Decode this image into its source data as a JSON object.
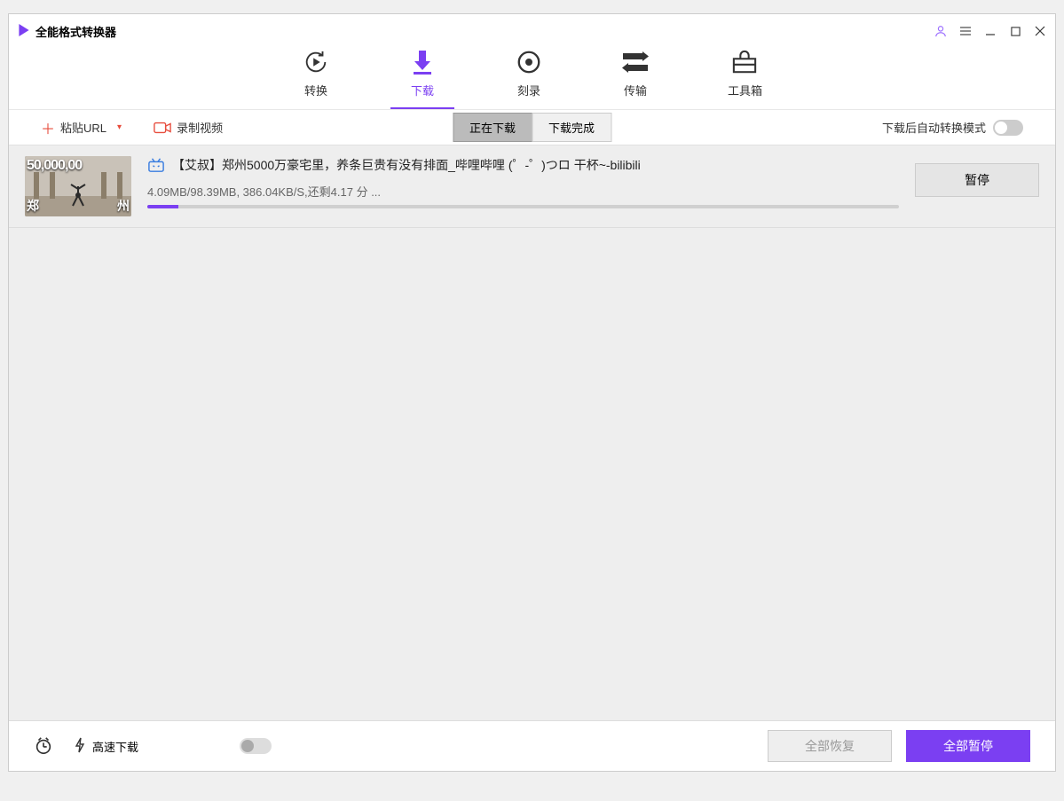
{
  "app": {
    "title": "全能格式转换器"
  },
  "nav": {
    "items": [
      {
        "label": "转换"
      },
      {
        "label": "下载"
      },
      {
        "label": "刻录"
      },
      {
        "label": "传输"
      },
      {
        "label": "工具箱"
      }
    ]
  },
  "toolbar": {
    "paste_url": "粘贴URL",
    "record_video": "录制视频",
    "seg_downloading": "正在下载",
    "seg_done": "下载完成",
    "auto_convert": "下载后自动转换模式"
  },
  "downloads": [
    {
      "title": "【艾叔】郑州5000万豪宅里，养条巨贵有没有排面_哔哩哔哩 (゜-゜)つロ 干杯~-bilibili",
      "stats": "4.09MB/98.39MB, 386.04KB/S,还剩4.17 分 ...",
      "pause": "暂停",
      "progress_pct": 4.1
    }
  ],
  "footer": {
    "speed": "高速下载",
    "restore_all": "全部恢复",
    "pause_all": "全部暂停"
  }
}
